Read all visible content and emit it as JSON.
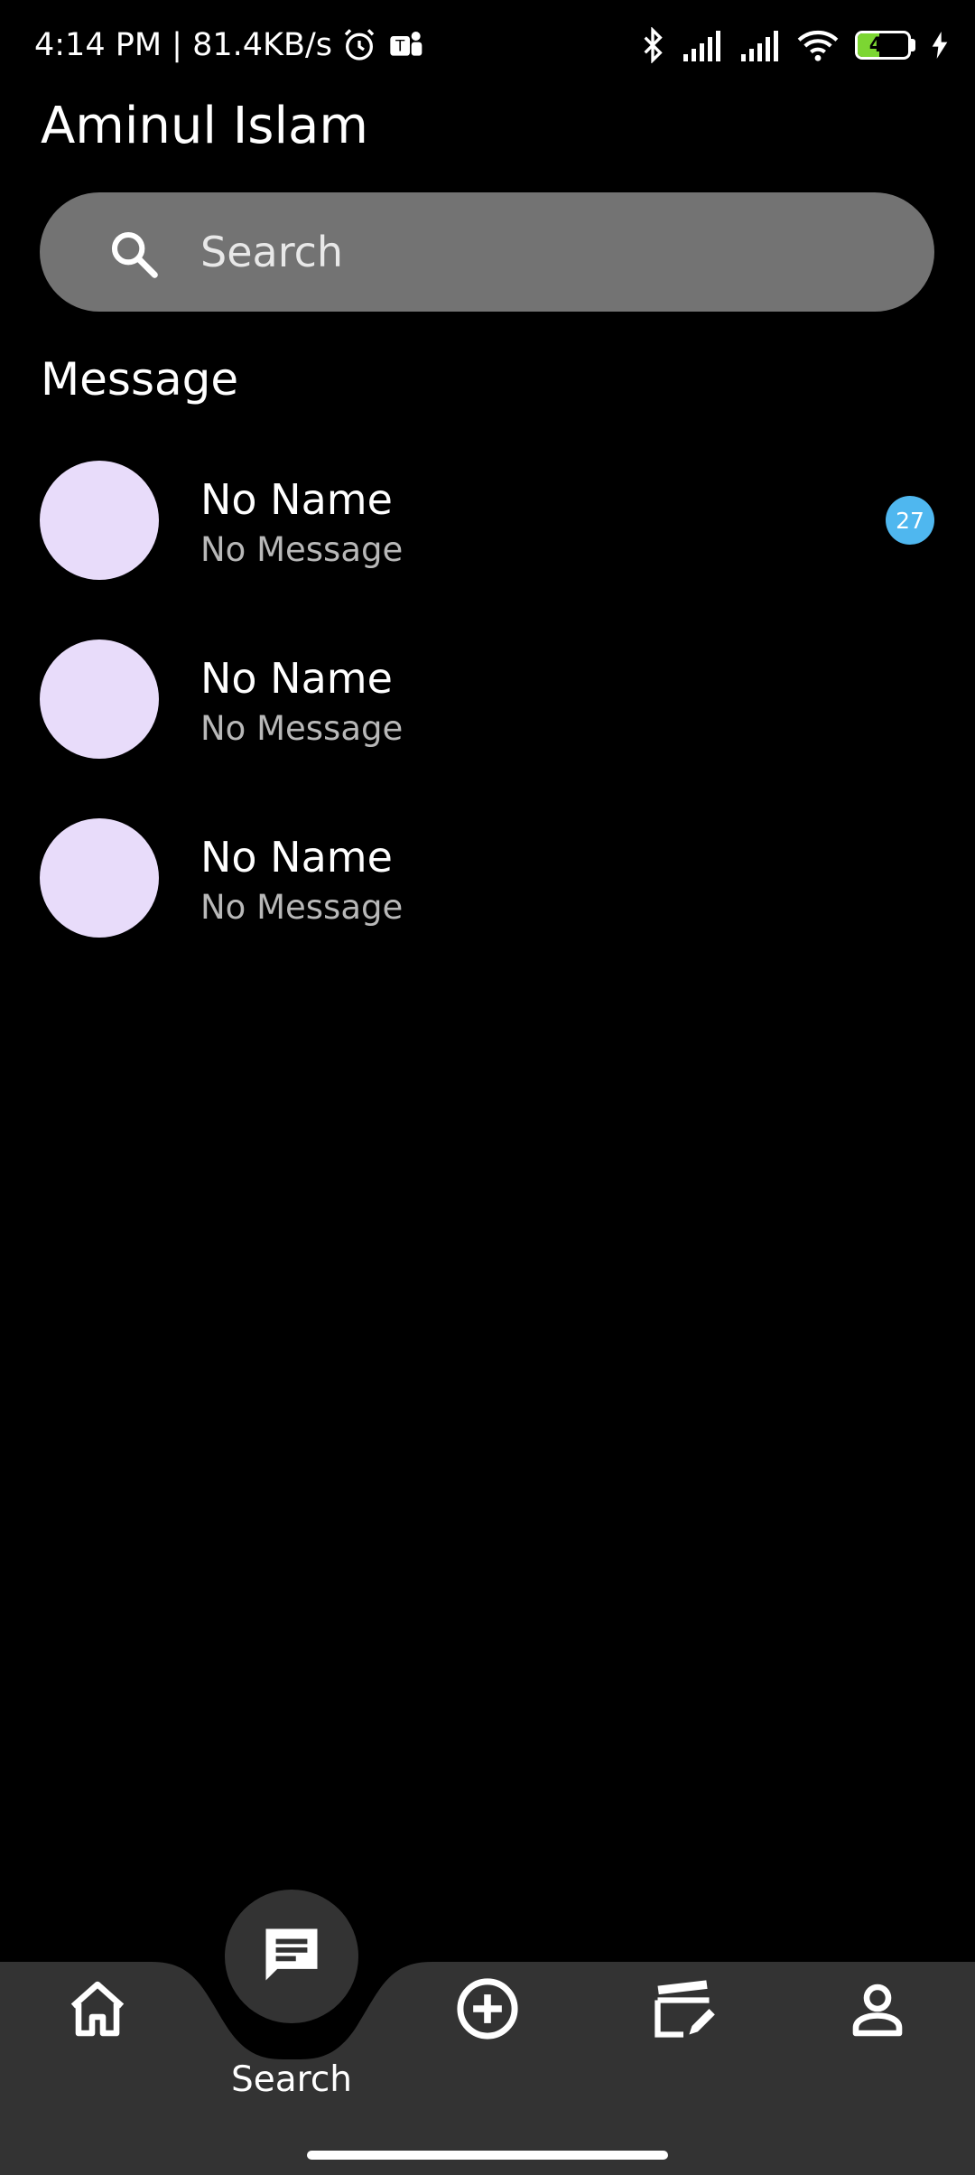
{
  "status_bar": {
    "time_speed": "4:14 PM | 81.4KB/s",
    "battery_level": "42",
    "battery_color": "#7cd632",
    "icons": [
      "alarm-icon",
      "teams-icon",
      "bluetooth-icon",
      "signal-icon",
      "signal-icon",
      "wifi-icon",
      "battery-icon",
      "charging-icon"
    ]
  },
  "header": {
    "title": "Aminul Islam"
  },
  "search": {
    "placeholder": "Search"
  },
  "section": {
    "title": "Message"
  },
  "conversations": [
    {
      "name": "No Name",
      "message": "No Message",
      "badge": "27"
    },
    {
      "name": "No Name",
      "message": "No Message",
      "badge": ""
    },
    {
      "name": "No Name",
      "message": "No Message",
      "badge": ""
    }
  ],
  "bottom_nav": {
    "active_label": "Search",
    "items": [
      "home-icon",
      "message-icon",
      "add-circle-icon",
      "video-edit-icon",
      "person-icon"
    ]
  },
  "colors": {
    "background": "#000000",
    "search_bg": "#737373",
    "avatar": "#e8dcfa",
    "badge": "#4fb7ef",
    "nav_bg": "#333333"
  }
}
